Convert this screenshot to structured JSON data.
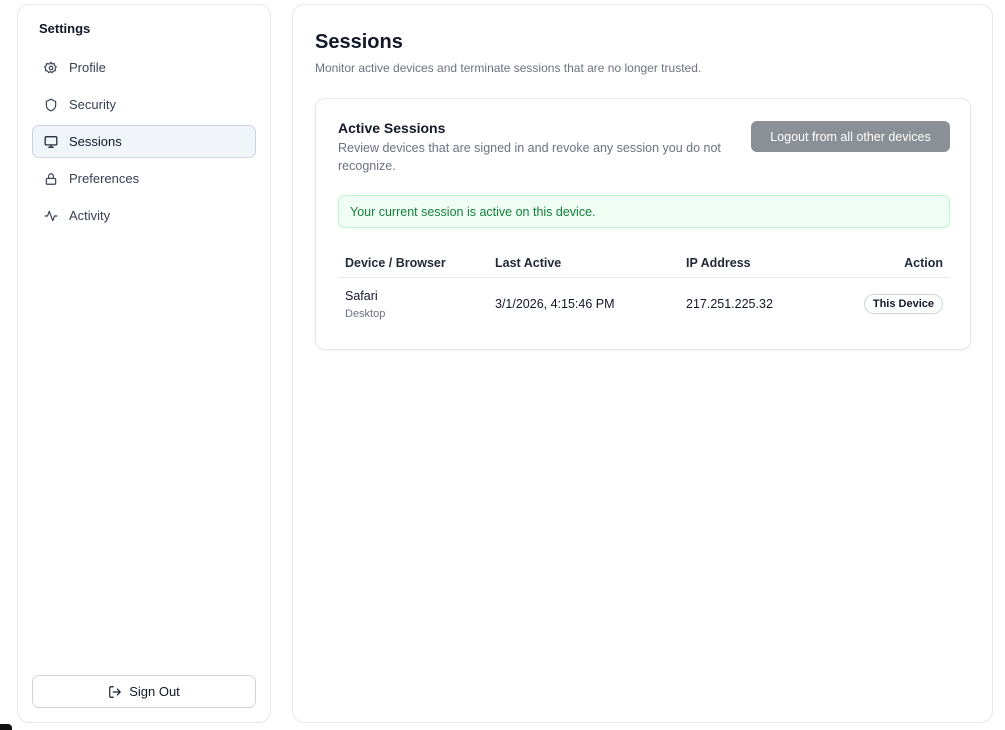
{
  "sidebar": {
    "title": "Settings",
    "items": [
      {
        "label": "Profile",
        "icon": "gear-icon"
      },
      {
        "label": "Security",
        "icon": "shield-icon"
      },
      {
        "label": "Sessions",
        "icon": "monitor-icon"
      },
      {
        "label": "Preferences",
        "icon": "lock-icon"
      },
      {
        "label": "Activity",
        "icon": "activity-icon"
      }
    ],
    "active": "Sessions",
    "sign_out_label": "Sign Out"
  },
  "page": {
    "title": "Sessions",
    "subtitle": "Monitor active devices and terminate sessions that are no longer trusted."
  },
  "card": {
    "title": "Active Sessions",
    "subtitle": "Review devices that are signed in and revoke any session you do not recognize.",
    "logout_all_label": "Logout from all other devices",
    "alert": "Your current session is active on this device."
  },
  "table": {
    "columns": [
      "Device / Browser",
      "Last Active",
      "IP Address",
      "Action"
    ],
    "rows": [
      {
        "browser": "Safari",
        "device": "Desktop",
        "last_active": "3/1/2026, 4:15:46 PM",
        "ip": "217.251.225.32",
        "action": "This Device"
      }
    ]
  },
  "colors": {
    "accent_active_bg": "#f1f5f9",
    "logout_button": "#8b8f96",
    "success_bg": "#f0fdf4",
    "success_text": "#15803d"
  }
}
